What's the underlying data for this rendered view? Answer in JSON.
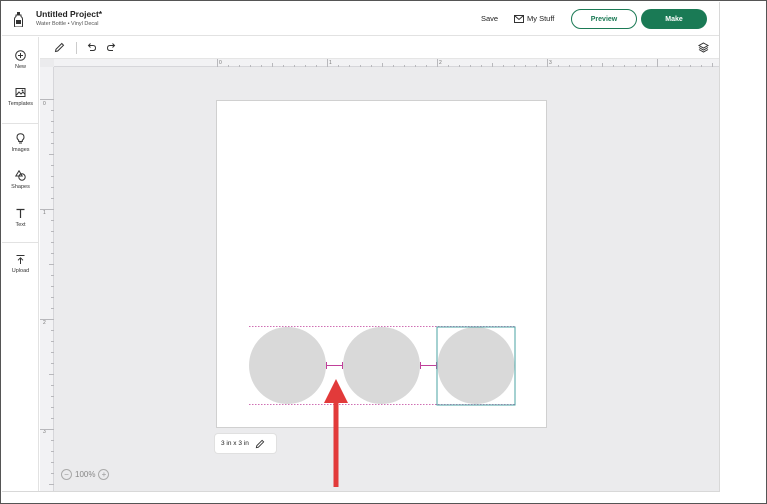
{
  "header": {
    "project_title": "Untitled Project*",
    "project_subtitle": "Water Bottle • Vinyl Decal",
    "save_label": "Save",
    "mystuff_label": "My Stuff",
    "preview_label": "Preview",
    "make_label": "Make"
  },
  "sidebar": {
    "items": [
      {
        "label": "New",
        "icon": "plus-circle-icon"
      },
      {
        "label": "Templates",
        "icon": "templates-icon"
      },
      {
        "label": "Images",
        "icon": "lightbulb-icon"
      },
      {
        "label": "Shapes",
        "icon": "shapes-icon"
      },
      {
        "label": "Text",
        "icon": "text-icon"
      },
      {
        "label": "Upload",
        "icon": "upload-icon"
      }
    ]
  },
  "toolbar": {
    "icons": [
      "pencil-icon",
      "undo-icon",
      "redo-icon",
      "layers-icon"
    ]
  },
  "rulers": {
    "top": [
      "0",
      "1",
      "2",
      "3"
    ],
    "left": [
      "0",
      "1",
      "2",
      "3"
    ]
  },
  "canvas": {
    "size_label": "3 in x 3 in",
    "zoom_label": "100%",
    "shape_fill": "#d9d9d9",
    "guide_color": "#c0409a",
    "selection_color": "#4aa3a3",
    "arrow_color": "#e23a3a"
  },
  "colors": {
    "accent": "#1a7a55"
  }
}
